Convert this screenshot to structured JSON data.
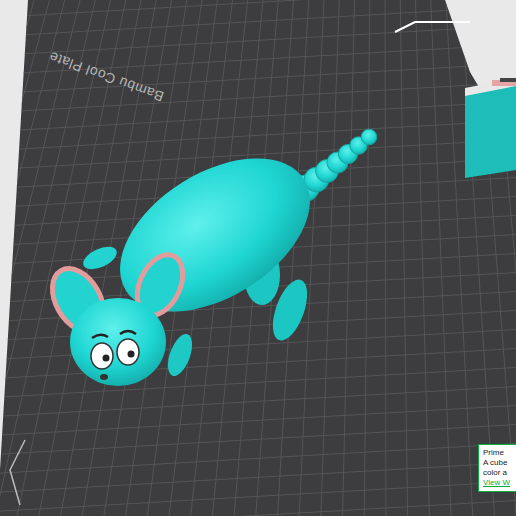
{
  "plate": {
    "label": "Bambu Cool Plate"
  },
  "notification": {
    "lines": [
      "Prime",
      "A cube",
      "color a"
    ],
    "link": "View W"
  }
}
